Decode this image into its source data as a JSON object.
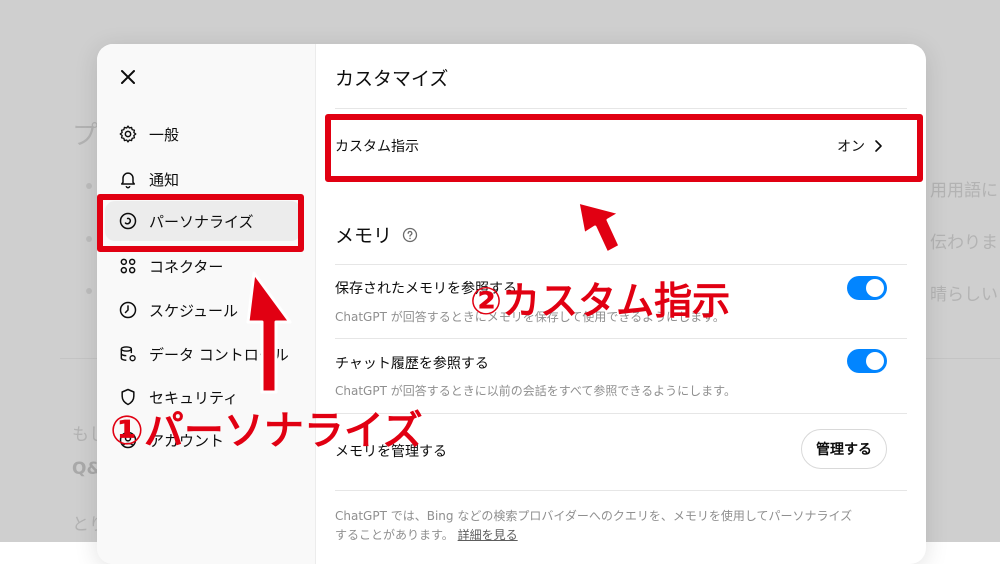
{
  "background": {
    "heading_fragment": "プ",
    "right_fragments": [
      "用用語に",
      "伝わりま",
      "晴らしい"
    ],
    "left_fragments": [
      "もし",
      "Q&",
      "とり"
    ]
  },
  "sidebar": {
    "close_icon": "close-icon",
    "items": [
      {
        "label": "一般",
        "icon": "gear-icon"
      },
      {
        "label": "通知",
        "icon": "bell-icon"
      },
      {
        "label": "パーソナライズ",
        "icon": "personalize-icon",
        "active": true
      },
      {
        "label": "コネクター",
        "icon": "connector-icon"
      },
      {
        "label": "スケジュール",
        "icon": "clock-icon"
      },
      {
        "label": "データ コントロール",
        "icon": "database-gear-icon"
      },
      {
        "label": "セキュリティ",
        "icon": "shield-icon"
      },
      {
        "label": "アカウント",
        "icon": "account-icon"
      }
    ]
  },
  "content": {
    "title": "カスタマイズ",
    "custom_instructions": {
      "label": "カスタム指示",
      "value": "オン"
    },
    "memory": {
      "title": "メモリ",
      "saved_memory": {
        "label": "保存されたメモリを参照する",
        "description": "ChatGPT が回答するときにメモリを保存して使用できるようにします。",
        "enabled": true
      },
      "chat_history": {
        "label": "チャット履歴を参照する",
        "description": "ChatGPT が回答するときに以前の会話をすべて参照できるようにします。",
        "enabled": true
      },
      "manage": {
        "label": "メモリを管理する",
        "button": "管理する"
      }
    },
    "footer": {
      "text": "ChatGPT では、Bing などの検索プロバイダーへのクエリを、メモリを使用してパーソナライズすることがあります。",
      "link": "詳細を見る"
    }
  },
  "annotations": {
    "step1": "①パーソナライズ",
    "step2": "②カスタム指示",
    "color": "#e10012"
  }
}
